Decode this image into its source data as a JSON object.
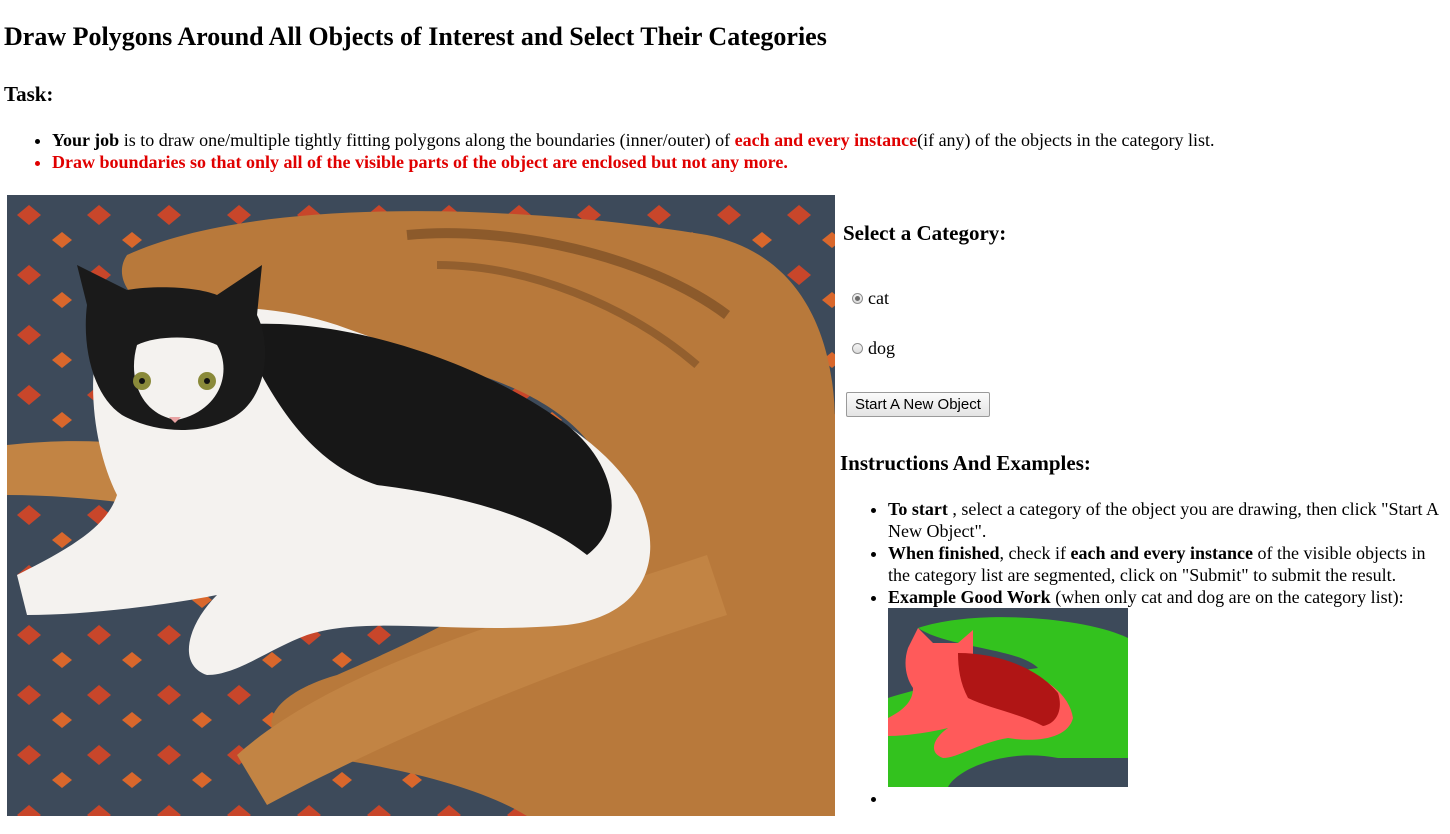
{
  "title": "Draw Polygons Around All Objects of Interest and Select Their Categories",
  "task": {
    "heading": "Task:",
    "bullet1": {
      "bold": "Your job",
      "text1": " is to draw one/multiple tightly fitting polygons along the boundaries (inner/outer) of ",
      "red_bold": "each and every instance",
      "text2": "(if any) of the objects in the category list."
    },
    "bullet2": "Draw boundaries so that only all of the visible parts of the object are enclosed but not any more."
  },
  "category": {
    "heading": "Select a Category:",
    "options": [
      {
        "label": "cat",
        "selected": true
      },
      {
        "label": "dog",
        "selected": false
      }
    ]
  },
  "new_object_button": "Start A New Object",
  "instructions": {
    "heading": "Instructions And Examples:",
    "item1": {
      "bold": "To start",
      "text": " , select a category of the object you are drawing, then click \"Start A New Object\"."
    },
    "item2": {
      "bold": "When finished",
      "text1": ", check if ",
      "bold2": "each and every instance",
      "text2": " of the visible objects in the category list are segmented, click on \"Submit\" to submit the result."
    },
    "item3": {
      "bold": "Example Good Work",
      "text": " (when only cat and dog are on the category list):"
    }
  },
  "colors": {
    "accent_red": "#e00000",
    "cat_overlay": "#ff5a5a",
    "dog_overlay": "#33c21e"
  }
}
